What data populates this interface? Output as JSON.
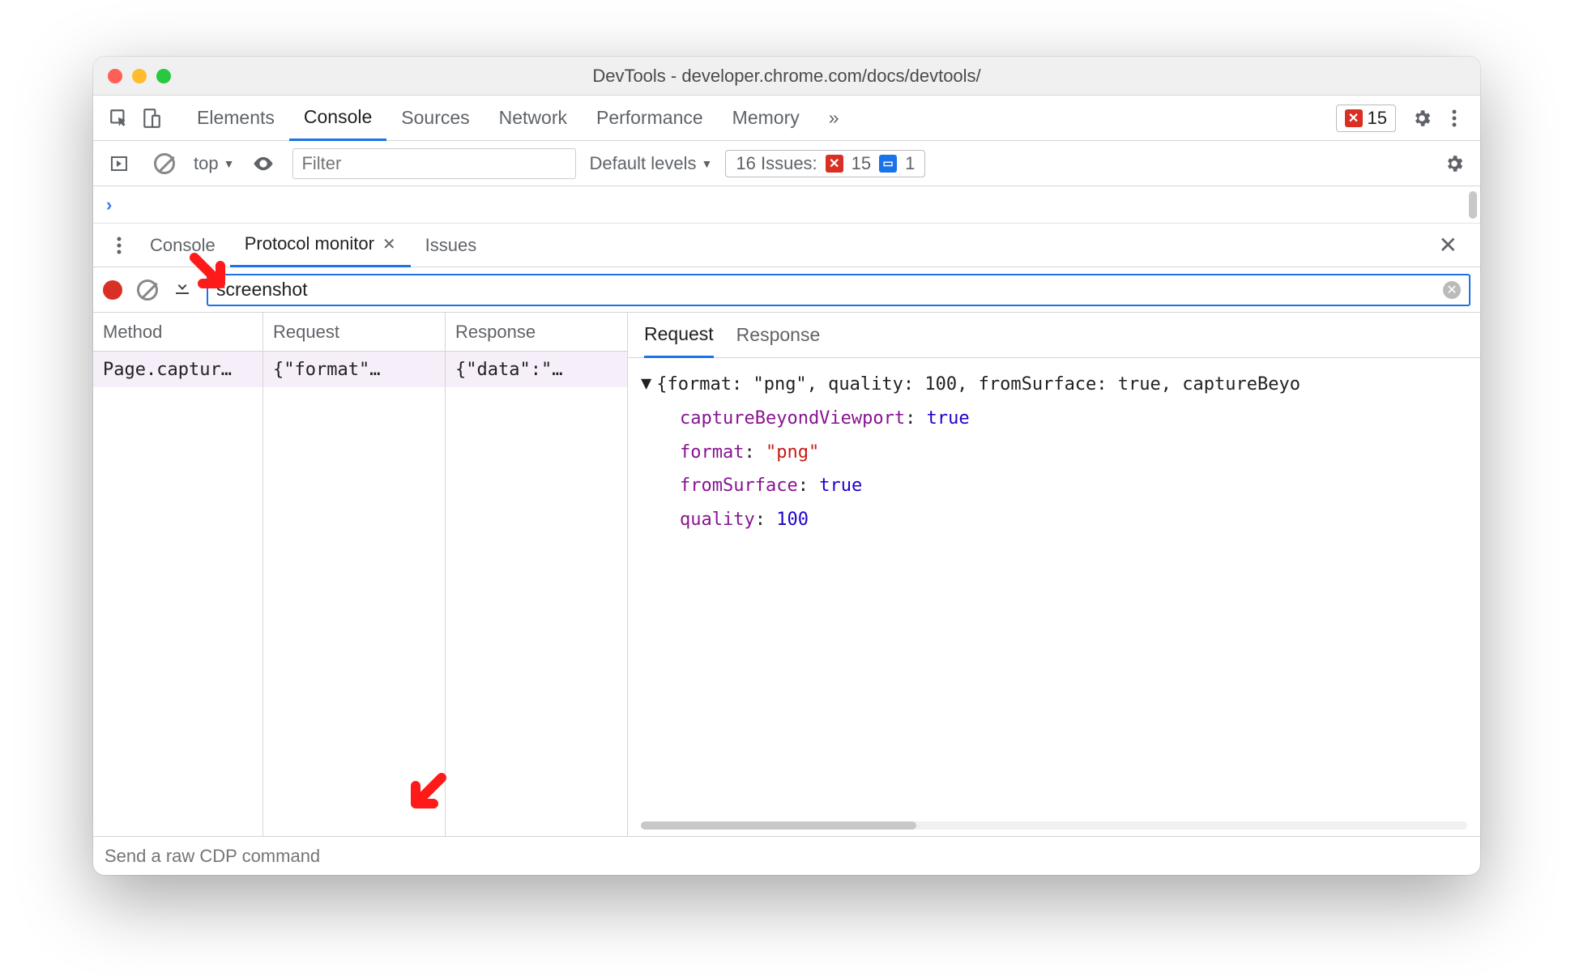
{
  "window": {
    "title": "DevTools - developer.chrome.com/docs/devtools/"
  },
  "tabs": {
    "items": [
      "Elements",
      "Console",
      "Sources",
      "Network",
      "Performance",
      "Memory"
    ],
    "active": "Console",
    "overflow_glyph": "»",
    "error_count": "15"
  },
  "console_toolbar": {
    "context": "top",
    "filter_placeholder": "Filter",
    "levels": "Default levels",
    "issues_label": "16 Issues:",
    "issues_err": "15",
    "issues_info": "1"
  },
  "drawer": {
    "tabs": [
      "Console",
      "Protocol monitor",
      "Issues"
    ],
    "active": "Protocol monitor"
  },
  "pm": {
    "filter_value": "screenshot",
    "headers": [
      "Method",
      "Request",
      "Response"
    ],
    "rows": [
      {
        "method": "Page.captur…",
        "request": "{\"format\"…",
        "response": "{\"data\":\"…"
      }
    ],
    "detail_tabs": [
      "Request",
      "Response"
    ],
    "detail_active": "Request",
    "json_summary": "{format: \"png\", quality: 100, fromSurface: true, captureBeyo",
    "json_props": [
      {
        "key": "captureBeyondViewport",
        "val": "true",
        "type": "bool"
      },
      {
        "key": "format",
        "val": "\"png\"",
        "type": "str"
      },
      {
        "key": "fromSurface",
        "val": "true",
        "type": "bool"
      },
      {
        "key": "quality",
        "val": "100",
        "type": "num"
      }
    ]
  },
  "cmd": {
    "placeholder": "Send a raw CDP command"
  }
}
